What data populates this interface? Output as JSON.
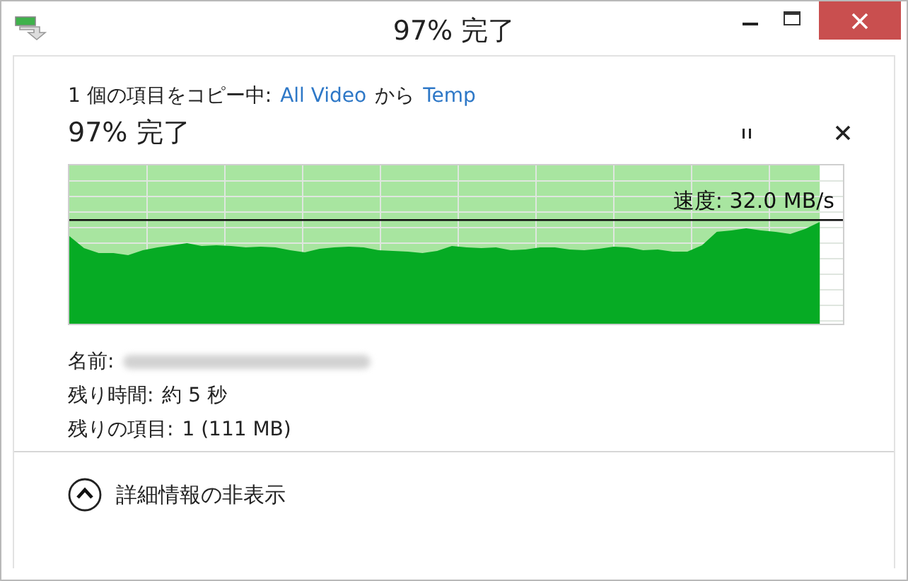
{
  "window": {
    "title": "97% 完了"
  },
  "header": {
    "parts": [
      {
        "text": "1 個の項目をコピー中:",
        "kind": "plain"
      },
      {
        "text": "All Video",
        "kind": "link"
      },
      {
        "text": "から",
        "kind": "plain"
      },
      {
        "text": "Temp",
        "kind": "link"
      }
    ]
  },
  "progress": {
    "title": "97% 完了",
    "level": 0.97,
    "speed": "速度: 32.0 MB/s"
  },
  "details": [
    {
      "label": "名前:",
      "kind": "blurred"
    },
    {
      "label": "残り時間:",
      "value": "約 5 秒",
      "kind": "text"
    },
    {
      "label": "残りの項目:",
      "value": "1 (111 MB)",
      "kind": "text"
    }
  ],
  "toggle": {
    "label": "詳細情報の非表示",
    "expanded": true
  }
}
